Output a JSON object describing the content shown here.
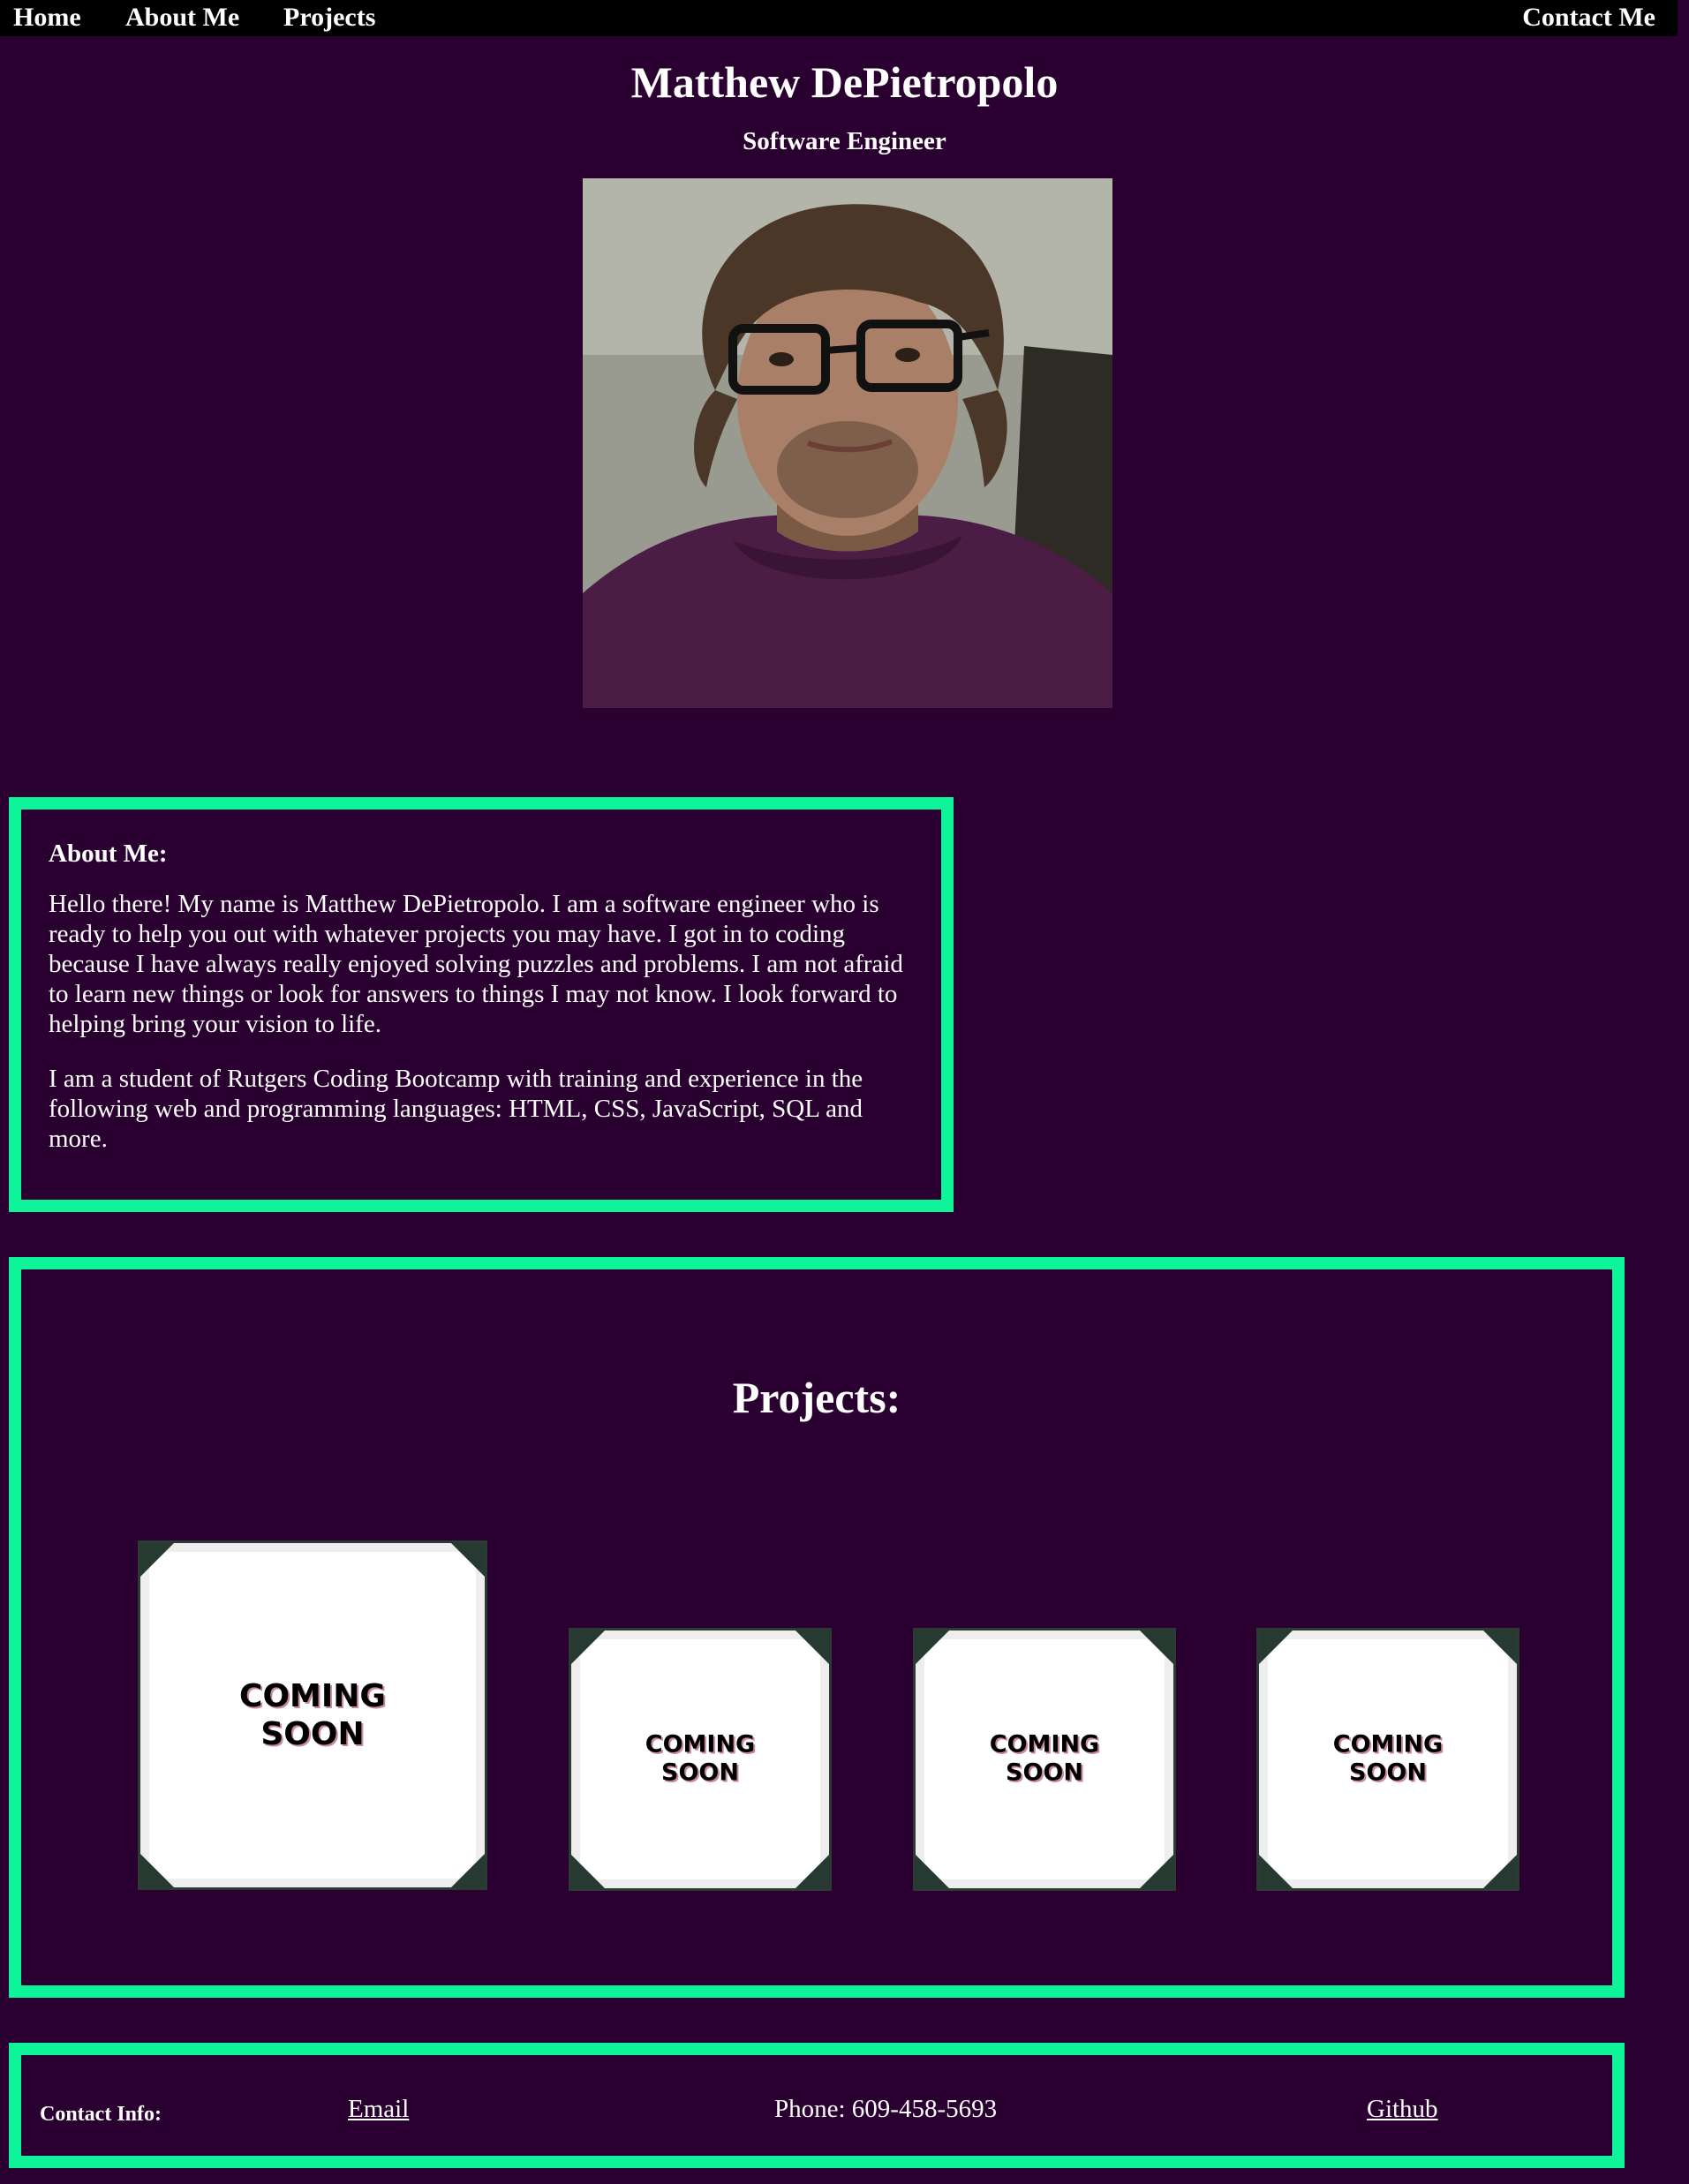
{
  "nav": {
    "home": "Home",
    "about": "About Me",
    "projects": "Projects",
    "contact": "Contact Me"
  },
  "header": {
    "name": "Matthew DePietropolo",
    "role": "Software Engineer"
  },
  "about": {
    "heading": "About Me:",
    "paragraph1": "Hello there! My name is Matthew DePietropolo. I am a software engineer who is ready to help you out with whatever projects you may have. I got in to coding because I have always really enjoyed solving puzzles and problems. I am not afraid to learn new things or look for answers to things I may not know. I look forward to helping bring your vision to life.",
    "paragraph2": "I am a student of Rutgers Coding Bootcamp with training and experience in the following web and programming languages: HTML, CSS, JavaScript, SQL and more."
  },
  "projects": {
    "title": "Projects:",
    "cards": [
      {
        "label": "COMING\nSOON"
      },
      {
        "label": "COMING\nSOON"
      },
      {
        "label": "COMING\nSOON"
      },
      {
        "label": "COMING\nSOON"
      }
    ]
  },
  "contact": {
    "label": "Contact Info:",
    "email": "Email",
    "phone": "Phone: 609-458-5693",
    "github": "Github"
  },
  "colors": {
    "background": "#2a0031",
    "accent": "#0ef49a",
    "nav_background": "#000000"
  }
}
